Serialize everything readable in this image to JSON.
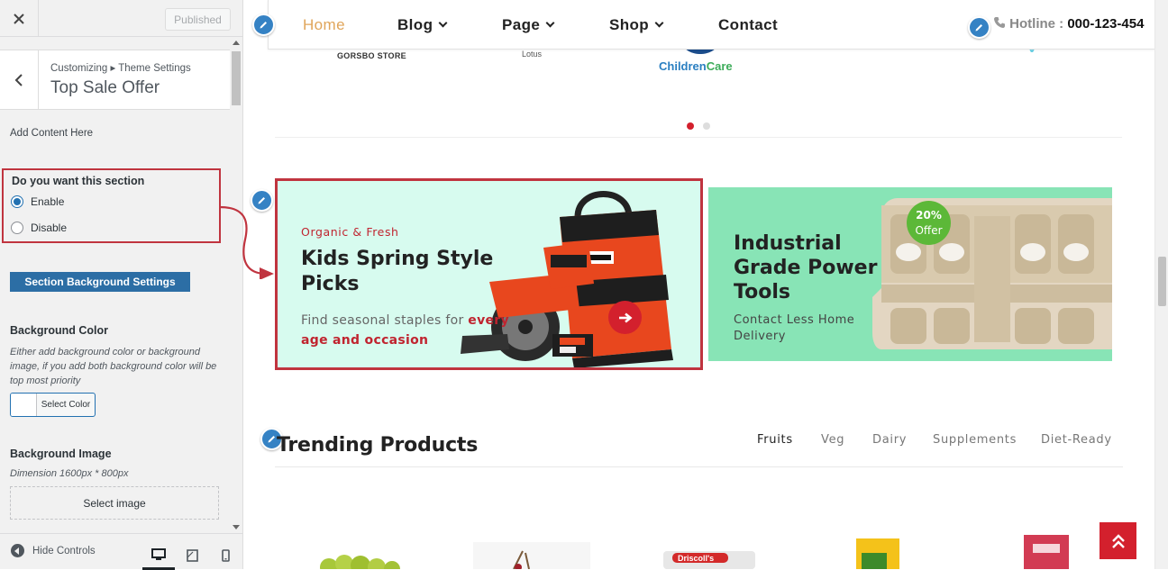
{
  "customizer": {
    "close_icon": "close-icon",
    "published_label": "Published",
    "breadcrumb": "Customizing ▸ Theme Settings",
    "section_title": "Top Sale Offer",
    "add_content": "Add Content Here",
    "section_question": "Do you want this section",
    "radio_enable": "Enable",
    "radio_disable": "Disable",
    "selected": "Enable",
    "bg_settings_button": "Section Background Settings",
    "bg_color_label": "Background Color",
    "bg_color_desc": "Either add background color or background image, if you add both background color will be top most priority",
    "select_color": "Select Color",
    "bg_image_label": "Background Image",
    "bg_image_dim": "Dimension 1600px * 800px",
    "select_image": "Select image",
    "hide_controls": "Hide Controls"
  },
  "nav": {
    "home": "Home",
    "blog": "Blog",
    "page": "Page",
    "shop": "Shop",
    "contact": "Contact",
    "hotline_label": "Hotline :",
    "hotline_number": "000-123-454"
  },
  "brands": {
    "gorsbo": "GORSBO STORE",
    "lotus": "Lotus",
    "children": "Children",
    "care": "Care"
  },
  "banner1": {
    "eyebrow": "Organic & Fresh",
    "title": "Kids Spring Style Picks",
    "desc_normal": "Find seasonal staples for ",
    "desc_highlight": "every age and occasion"
  },
  "banner2": {
    "title": "Industrial Grade Power Tools",
    "desc": "Contact Less Home Delivery",
    "badge_pct": "20%",
    "badge_text": "Offer"
  },
  "trending": {
    "title": "Trending Products",
    "tabs": [
      "Fruits",
      "Veg",
      "Dairy",
      "Supplements",
      "Diet-Ready"
    ],
    "active_tab": "Fruits"
  },
  "colors": {
    "accent_red": "#d3202d",
    "annotation_red": "#c0343f",
    "nav_active": "#e0a55a",
    "banner1_bg": "#d7fbef",
    "banner2_bg": "#88e4b6",
    "wp_blue": "#2271b1"
  }
}
